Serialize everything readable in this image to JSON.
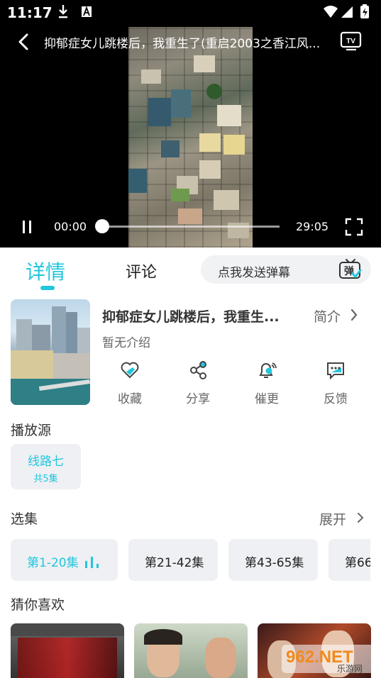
{
  "status_bar": {
    "time": "11:17"
  },
  "player": {
    "title": "抑郁症女儿跳楼后，我重生了(重启2003之香江风...",
    "current_time": "00:00",
    "total_time": "29:05",
    "progress": 0.0
  },
  "tabs": {
    "detail": "详情",
    "comment": "评论"
  },
  "danmu": {
    "placeholder": "点我发送弹幕",
    "icon_text": "弹"
  },
  "info": {
    "title": "抑郁症女儿跳楼后，我重生...",
    "intro_link": "简介",
    "intro_text": "暂无介绍",
    "actions": [
      {
        "label": "收藏",
        "icon": "heart-icon"
      },
      {
        "label": "分享",
        "icon": "share-icon"
      },
      {
        "label": "催更",
        "icon": "bell-icon"
      },
      {
        "label": "反馈",
        "icon": "feedback-icon"
      }
    ]
  },
  "source": {
    "section_title": "播放源",
    "name": "线路七",
    "count": "共5集"
  },
  "episodes": {
    "section_title": "选集",
    "expand_label": "展开",
    "items": [
      "第1-20集",
      "第21-42集",
      "第43-65集",
      "第66"
    ]
  },
  "recommend": {
    "section_title": "猜你喜欢"
  },
  "watermark": {
    "text": "962.NET",
    "subtext": "乐游网"
  },
  "colors": {
    "accent": "#22c6dd",
    "chip_bg": "#eef0f3"
  }
}
